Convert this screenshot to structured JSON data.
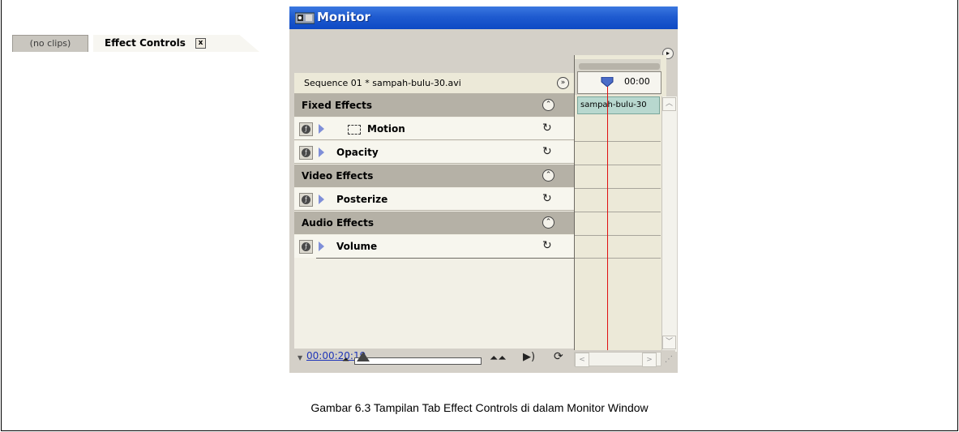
{
  "window": {
    "title": "Monitor",
    "tabs": [
      {
        "label": "(no clips)"
      },
      {
        "label": "Effect Controls"
      }
    ],
    "close_glyph": "x",
    "menu_glyph": "▸"
  },
  "sequence": {
    "label": "Sequence 01 * sampah-bulu-30.avi",
    "clip_label": "sampah-bulu-30",
    "timecode_ruler": "00:00"
  },
  "groups": [
    {
      "label": "Fixed Effects",
      "effects": [
        "Motion",
        "Opacity"
      ]
    },
    {
      "label": "Video Effects",
      "effects": [
        "Posterize"
      ]
    },
    {
      "label": "Audio Effects",
      "effects": [
        "Volume"
      ]
    }
  ],
  "labels": {
    "fixed": "Fixed Effects",
    "motion": "Motion",
    "opacity": "Opacity",
    "video": "Video Effects",
    "posterize": "Posterize",
    "audio": "Audio Effects",
    "volume": "Volume"
  },
  "bottom": {
    "timecode": "00:00:20:19"
  },
  "icons": {
    "fx": "fx-toggle-icon",
    "expand": "disclosure-triangle-icon",
    "reset": "reset-icon",
    "collapse": "collapse-icon",
    "zoom_out": "zoom-out-icon",
    "zoom_in": "zoom-in-icon",
    "play_audio": "play-audio-icon",
    "loop": "loop-icon"
  },
  "caption": "Gambar 6.3 Tampilan Tab Effect Controls di dalam Monitor Window"
}
